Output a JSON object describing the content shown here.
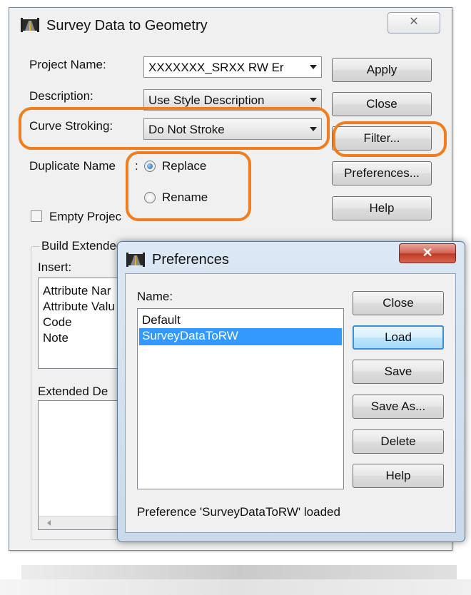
{
  "main_dialog": {
    "title": "Survey Data to Geometry",
    "close_glyph": "✕",
    "project_name_label": "Project Name:",
    "project_name_value": "XXXXXXX_SRXX RW Er",
    "description_label": "Description:",
    "description_value": "Use Style Description",
    "curve_stroking_label": "Curve Stroking:",
    "curve_stroking_value": "Do Not Stroke",
    "duplicate_names_label": "Duplicate Name",
    "duplicate_names_colon": ":",
    "radio_replace": "Replace",
    "radio_rename": "Rename",
    "empty_project_label": "Empty Projec",
    "build_extended_label": "Build Extended",
    "insert_label": "Insert:",
    "insert_items": [
      "Attribute Nar",
      "Attribute Valu",
      "Code",
      "Note"
    ],
    "extended_desc_label": "Extended De",
    "buttons": {
      "apply": "Apply",
      "close": "Close",
      "filter": "Filter...",
      "preferences": "Preferences...",
      "help": "Help"
    }
  },
  "preferences_dialog": {
    "title": "Preferences",
    "close_glyph": "✕",
    "name_label": "Name:",
    "names": [
      "Default",
      "SurveyDataToRW"
    ],
    "selected_name": "SurveyDataToRW",
    "buttons": {
      "close": "Close",
      "load": "Load",
      "save": "Save",
      "save_as": "Save As...",
      "delete": "Delete",
      "help": "Help"
    },
    "status": "Preference 'SurveyDataToRW' loaded"
  },
  "icons": {
    "app": "road-app-icon",
    "dropdown": "chevron-down-icon"
  },
  "colors": {
    "highlight_annotation": "#f07d1e",
    "selection": "#3399ff",
    "close_button_red": "#c13a25"
  }
}
